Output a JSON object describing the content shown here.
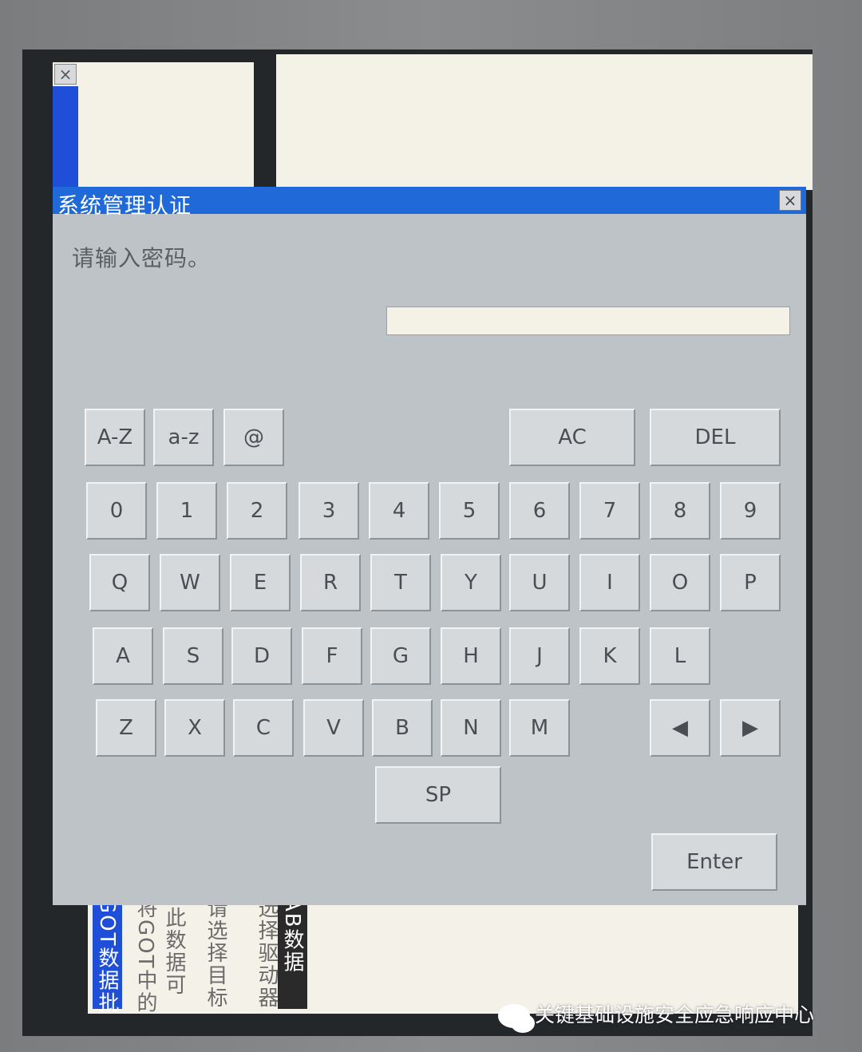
{
  "dialog": {
    "title": "系统管理认证",
    "close": "×",
    "prompt": "请输入密码。",
    "password_value": ""
  },
  "keyboard": {
    "mode_keys": [
      "A-Z",
      "a-z",
      "@"
    ],
    "ac": "AC",
    "del": "DEL",
    "row_digits": [
      "0",
      "1",
      "2",
      "3",
      "4",
      "5",
      "6",
      "7",
      "8",
      "9"
    ],
    "row_q": [
      "Q",
      "W",
      "E",
      "R",
      "T",
      "Y",
      "U",
      "I",
      "O",
      "P"
    ],
    "row_a": [
      "A",
      "S",
      "D",
      "F",
      "G",
      "H",
      "J",
      "K",
      "L"
    ],
    "row_z": [
      "Z",
      "X",
      "C",
      "V",
      "B",
      "N",
      "M"
    ],
    "left": "◀",
    "right": "▶",
    "space": "SP",
    "enter": "Enter"
  },
  "background": {
    "left_window_close": "×",
    "bottom_texts": [
      "GOT数据批",
      "将GOT中的",
      "(此数据可",
      "请选择目标",
      "选择驱动器",
      "AB数据"
    ]
  },
  "watermark": "关键基础设施安全应急响应中心",
  "colors": {
    "titlebar": "#1f6ad8",
    "dialog_bg": "#bec3c7",
    "key_bg": "#d6d9dc",
    "field_bg": "#f4f1e6"
  }
}
